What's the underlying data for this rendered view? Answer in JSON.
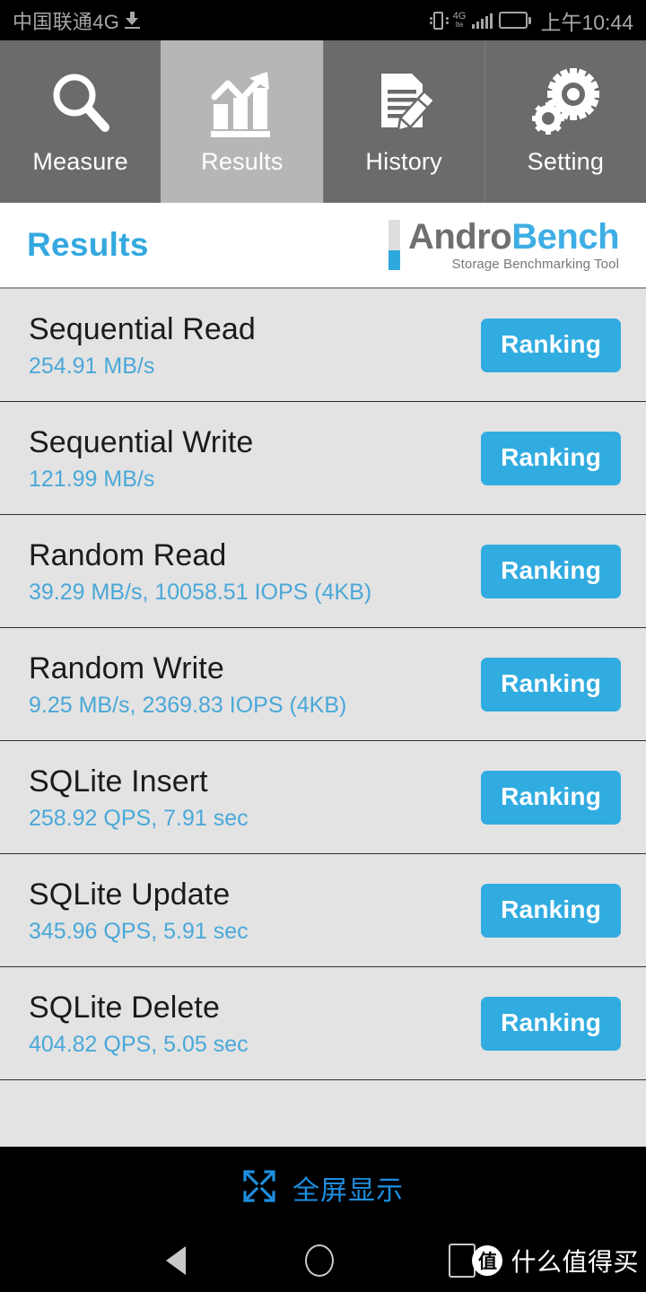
{
  "statusbar": {
    "carrier": "中国联通4G",
    "download_icon": "download-icon",
    "vibrate_icon": "vibrate-icon",
    "network_label": "4G",
    "network_sub": "lte",
    "signal_icon": "signal-bars-icon",
    "battery_icon": "battery-icon",
    "clock": "上午10:44"
  },
  "tabs": [
    {
      "label": "Measure",
      "icon": "magnifier-icon",
      "active": false
    },
    {
      "label": "Results",
      "icon": "bar-chart-trend-icon",
      "active": true
    },
    {
      "label": "History",
      "icon": "document-pencil-icon",
      "active": false
    },
    {
      "label": "Setting",
      "icon": "gears-icon",
      "active": false
    }
  ],
  "header": {
    "title": "Results",
    "logo_main_1": "Andro",
    "logo_main_2": "Bench",
    "logo_sub": "Storage Benchmarking Tool"
  },
  "results": [
    {
      "title": "Sequential Read",
      "value": "254.91 MB/s",
      "button": "Ranking"
    },
    {
      "title": "Sequential Write",
      "value": "121.99 MB/s",
      "button": "Ranking"
    },
    {
      "title": "Random Read",
      "value": "39.29 MB/s, 10058.51 IOPS (4KB)",
      "button": "Ranking"
    },
    {
      "title": "Random Write",
      "value": "9.25 MB/s, 2369.83 IOPS (4KB)",
      "button": "Ranking"
    },
    {
      "title": "SQLite Insert",
      "value": "258.92 QPS, 7.91 sec",
      "button": "Ranking"
    },
    {
      "title": "SQLite Update",
      "value": "345.96 QPS, 5.91 sec",
      "button": "Ranking"
    },
    {
      "title": "SQLite Delete",
      "value": "404.82 QPS, 5.05 sec",
      "button": "Ranking"
    }
  ],
  "fullscreen": {
    "label": "全屏显示",
    "icon": "expand-arrows-icon"
  },
  "navbar": {
    "back_icon": "back-triangle-icon",
    "home_icon": "home-circle-icon",
    "recents_icon": "recents-square-icon",
    "watermark_logo": "值",
    "watermark_text": "什么值得买"
  },
  "colors": {
    "accent_blue": "#31ace0",
    "title_blue": "#34a8df",
    "value_blue": "#4aa8d8",
    "tab_inactive": "#6b6b6b",
    "tab_active": "#b6b6b6",
    "row_bg": "#e3e3e3",
    "logo_gray": "#6f6f6f"
  }
}
